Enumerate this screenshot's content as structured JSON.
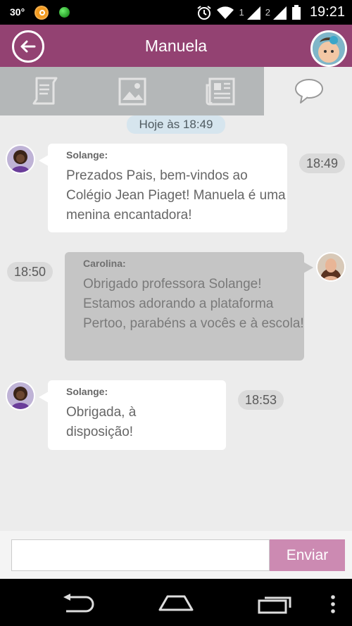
{
  "status_bar": {
    "temperature": "30°",
    "time": "19:21",
    "sim1": "1",
    "sim2": "2"
  },
  "header": {
    "title": "Manuela"
  },
  "tabs": [
    {
      "name": "tab-documents",
      "icon": "scroll-icon",
      "active": false
    },
    {
      "name": "tab-photos",
      "icon": "image-icon",
      "active": false
    },
    {
      "name": "tab-news",
      "icon": "newspaper-icon",
      "active": false
    },
    {
      "name": "tab-chat",
      "icon": "speech-bubble-icon",
      "active": true
    }
  ],
  "chat": {
    "date_label": "Hoje às 18:49",
    "messages": [
      {
        "sender": "Solange:",
        "text": "Prezados Pais, bem-vindos ao Colégio Jean Piaget! Manuela é uma menina encantadora!",
        "time": "18:49"
      },
      {
        "sender": "Carolina:",
        "text": "Obrigado professora Solange! Estamos adorando a plataforma Pertoo, parabéns a vocês e à escola!",
        "time": "18:50"
      },
      {
        "sender": "Solange:",
        "text": "Obrigada, à disposição!",
        "time": "18:53"
      }
    ]
  },
  "composer": {
    "input_value": "",
    "send_label": "Enviar"
  },
  "colors": {
    "header": "#934272",
    "send_button": "#cc8ab2",
    "tab_bar": "#b4b7b8"
  }
}
